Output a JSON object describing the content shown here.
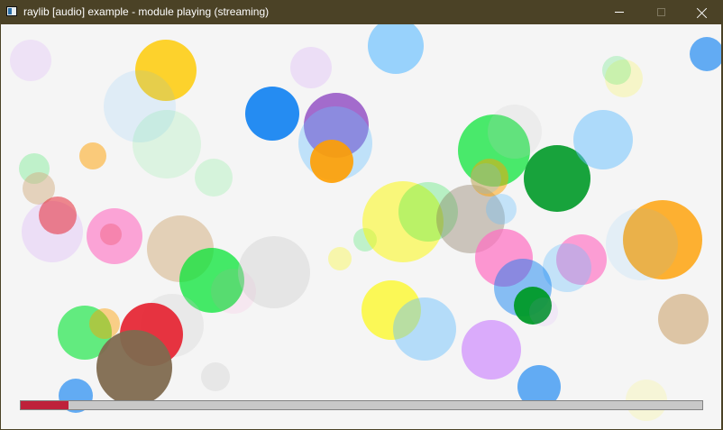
{
  "window": {
    "title": "raylib [audio] example - module playing (streaming)",
    "icon": "raylib-window-icon",
    "controls": {
      "minimize": "minimize-icon",
      "maximize": "maximize-icon",
      "close": "close-icon"
    }
  },
  "canvas": {
    "background": "#f5f5f5",
    "bubble_colors": [
      "#ffcb00",
      "#0079f1",
      "#873cbe",
      "#ff9f00",
      "#00e430",
      "#009a28",
      "#e62937",
      "#7f6a4f",
      "#fdf900",
      "#c8c8c8",
      "#ff6dc2",
      "#d3b083",
      "#66bfff",
      "#c87aff"
    ]
  },
  "music": {
    "progress": 0.07,
    "progress_color": "#be213a",
    "track_color": "#c8c8c8"
  }
}
